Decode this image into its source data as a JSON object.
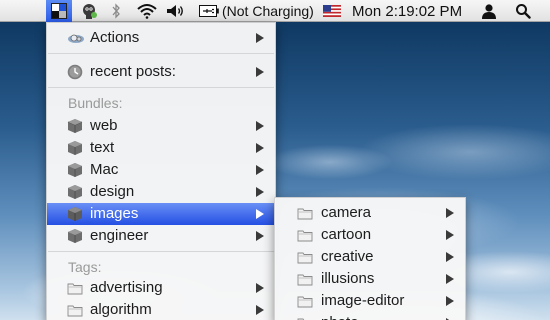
{
  "menubar": {
    "battery_status": "(Not Charging)",
    "clock": "Mon 2:19:02 PM"
  },
  "main_menu": {
    "actions_label": "Actions",
    "recent_label": "recent posts:",
    "bundles_header": "Bundles:",
    "bundles": [
      {
        "label": "web"
      },
      {
        "label": "text"
      },
      {
        "label": "Mac"
      },
      {
        "label": "design"
      },
      {
        "label": "images"
      },
      {
        "label": "engineer"
      }
    ],
    "tags_header": "Tags:",
    "tags": [
      {
        "label": "advertising"
      },
      {
        "label": "algorithm"
      }
    ]
  },
  "submenu": {
    "items": [
      {
        "label": "camera"
      },
      {
        "label": "cartoon"
      },
      {
        "label": "creative"
      },
      {
        "label": "illusions"
      },
      {
        "label": "image-editor"
      },
      {
        "label": "photo"
      }
    ]
  },
  "colors": {
    "selection": "#2450e3",
    "menubar_active": "#2b5cea",
    "bundle_cube": "#6e6e6e"
  }
}
